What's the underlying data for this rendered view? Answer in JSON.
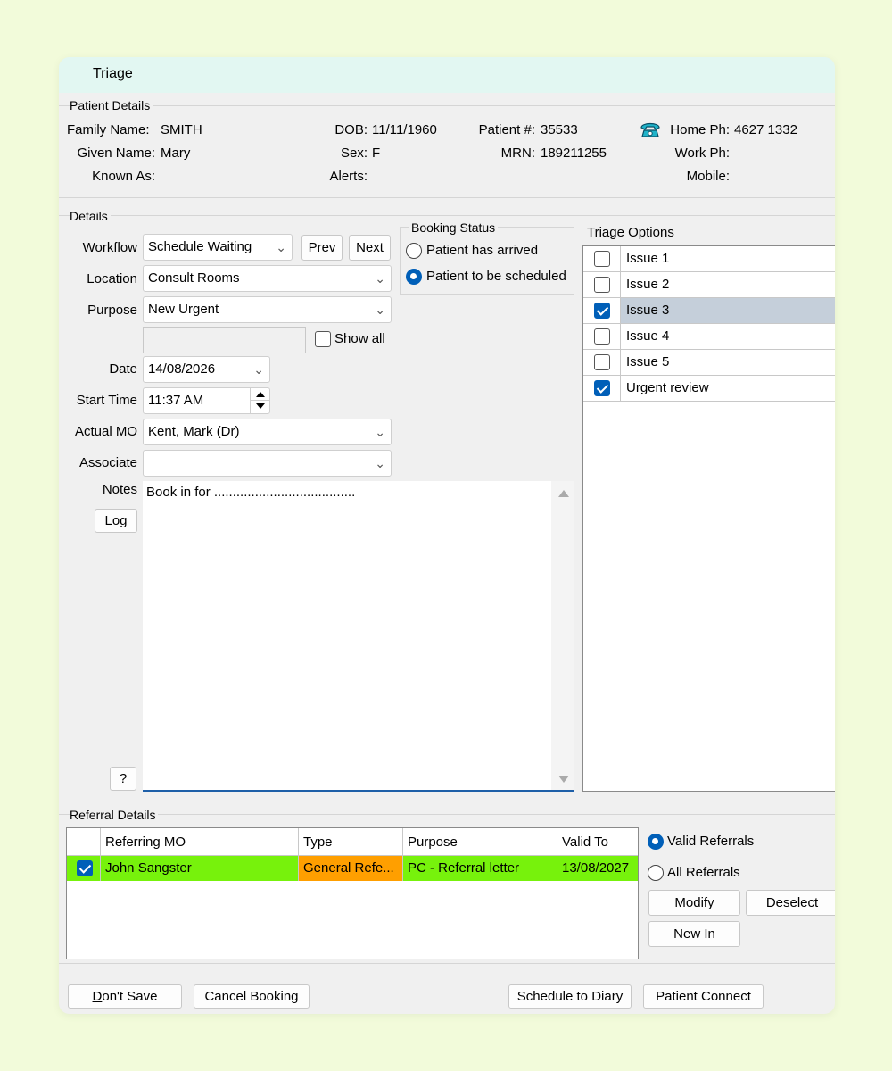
{
  "window": {
    "title": "Triage"
  },
  "patient": {
    "group_title": "Patient Details",
    "family_name_label": "Family Name:",
    "family_name": "SMITH",
    "given_name_label": "Given Name:",
    "given_name": "Mary",
    "known_as_label": "Known As:",
    "known_as": "",
    "dob_label": "DOB:",
    "dob": "11/11/1960",
    "sex_label": "Sex:",
    "sex": "F",
    "alerts_label": "Alerts:",
    "alerts": "",
    "patient_no_label": "Patient #:",
    "patient_no": "35533",
    "mrn_label": "MRN:",
    "mrn": "189211255",
    "home_ph_label": "Home Ph:",
    "home_ph": "4627 1332",
    "work_ph_label": "Work Ph:",
    "work_ph": "",
    "mobile_label": "Mobile:",
    "mobile": "",
    "phone_icon": "telephone-icon"
  },
  "details": {
    "group_title": "Details",
    "workflow_label": "Workflow",
    "workflow": "Schedule Waiting",
    "prev_label": "Prev",
    "next_label": "Next",
    "location_label": "Location",
    "location": "Consult Rooms",
    "purpose_label": "Purpose",
    "purpose": "New Urgent",
    "filter_value": "",
    "show_all_label": "Show all",
    "show_all_checked": false,
    "date_label": "Date",
    "date": "14/08/2026",
    "start_time_label": "Start Time",
    "start_time": "11:37 AM",
    "actual_mo_label": "Actual MO",
    "actual_mo": "Kent, Mark (Dr)",
    "associate_label": "Associate",
    "associate": "",
    "notes_label": "Notes",
    "notes": "Book in for ......................................",
    "log_label": "Log",
    "help_label": "?"
  },
  "booking_status": {
    "group_title": "Booking Status",
    "options": [
      {
        "label": "Patient has arrived",
        "selected": false
      },
      {
        "label": "Patient to be scheduled",
        "selected": true
      }
    ]
  },
  "triage": {
    "title": "Triage Options",
    "items": [
      {
        "label": "Issue 1",
        "checked": false,
        "highlighted": false
      },
      {
        "label": "Issue 2",
        "checked": false,
        "highlighted": false
      },
      {
        "label": "Issue 3",
        "checked": true,
        "highlighted": true
      },
      {
        "label": "Issue 4",
        "checked": false,
        "highlighted": false
      },
      {
        "label": "Issue 5",
        "checked": false,
        "highlighted": false
      },
      {
        "label": "Urgent review",
        "checked": true,
        "highlighted": false
      }
    ]
  },
  "referral": {
    "group_title": "Referral Details",
    "columns": [
      "Referring MO",
      "Type",
      "Purpose",
      "Valid To"
    ],
    "rows": [
      {
        "checked": true,
        "referring_mo": "John Sangster",
        "type": "General Refe...",
        "purpose": "PC - Referral letter",
        "valid_to": "13/08/2027"
      }
    ],
    "filter_options": [
      {
        "label": "Valid Referrals",
        "selected": true
      },
      {
        "label": "All Referrals",
        "selected": false
      }
    ],
    "modify_label": "Modify",
    "deselect_label": "Deselect",
    "new_in_label": "New In",
    "row_color": "#77f20c",
    "type_color": "#ff9f00"
  },
  "footer": {
    "dont_save_label": "Don't Save",
    "dont_save_accel": "D",
    "dont_save_rest": "on't Save",
    "cancel_booking_label": "Cancel Booking",
    "schedule_label": "Schedule to Diary",
    "patient_connect_label": "Patient Connect"
  }
}
